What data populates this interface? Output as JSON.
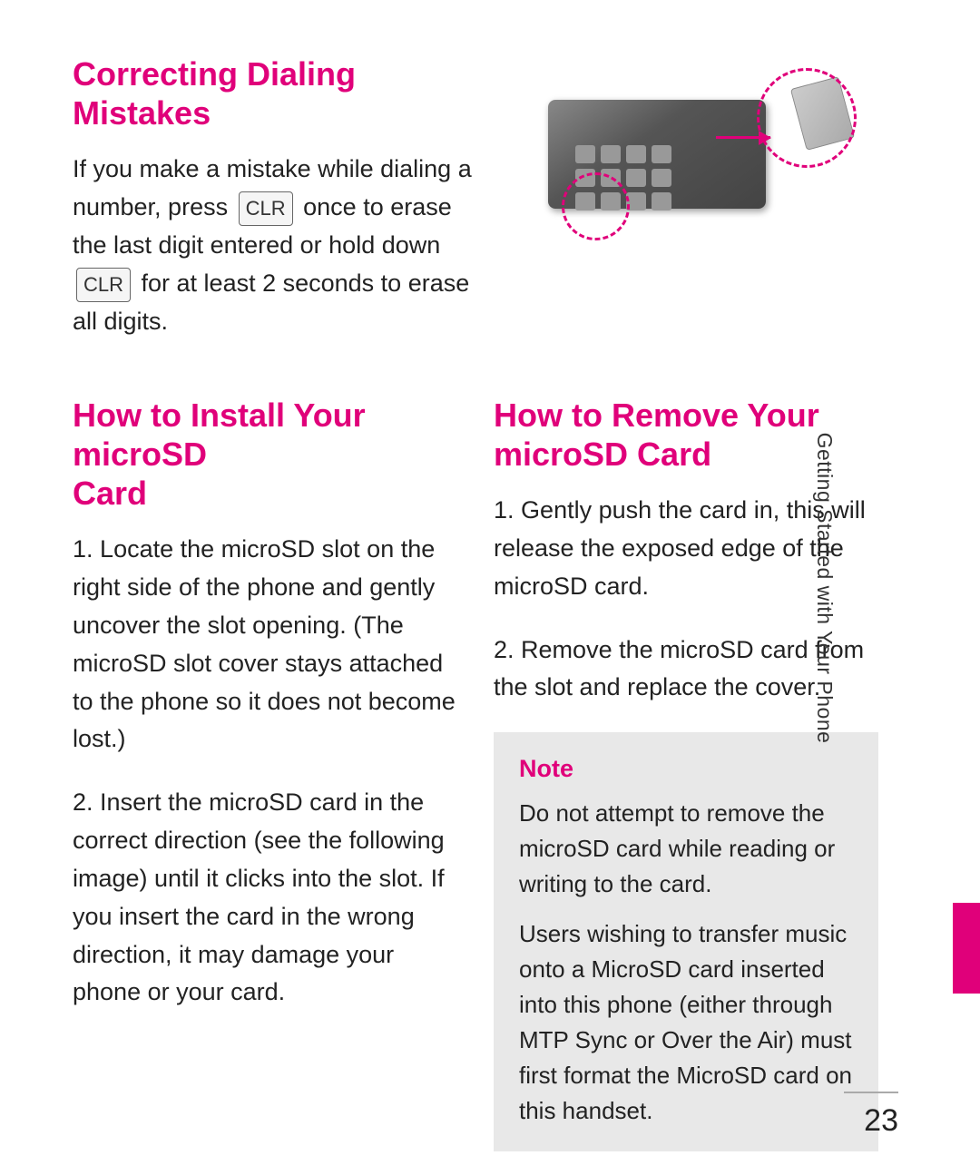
{
  "page": {
    "number": "23",
    "side_tab_text": "Getting Started with Your Phone"
  },
  "section1": {
    "title": "Correcting Dialing Mistakes",
    "body": "If you make a mistake while dialing a number, press",
    "body2": "once to erase the last digit entered or hold down",
    "body3": "for at least 2 seconds to erase all digits.",
    "clr_label": "CLR"
  },
  "section2": {
    "title_line1": "How to Install Your microSD",
    "title_line2": "Card",
    "items": [
      {
        "num": "1.",
        "text": "Locate the microSD slot on the right side of the phone and gently uncover the slot opening. (The microSD slot cover stays attached to the phone so it does not become lost.)"
      },
      {
        "num": "2.",
        "text": "Insert the microSD card in the correct direction (see the following image) until it clicks into the slot. If you insert the card in the wrong direction, it may damage your phone or your card."
      }
    ]
  },
  "section3": {
    "title_line1": "How to Remove Your",
    "title_line2": "microSD Card",
    "items": [
      {
        "num": "1.",
        "text": "Gently push the card in, this will release the exposed edge of the microSD card."
      },
      {
        "num": "2.",
        "text": "Remove the microSD card from the slot and replace the cover."
      }
    ]
  },
  "note": {
    "label": "Note",
    "paragraphs": [
      "Do not attempt to remove the microSD card while reading or writing to the card.",
      "Users wishing to transfer music onto a MicroSD card inserted into this phone (either through MTP Sync or Over the Air) must first format the MicroSD card on this handset."
    ]
  }
}
